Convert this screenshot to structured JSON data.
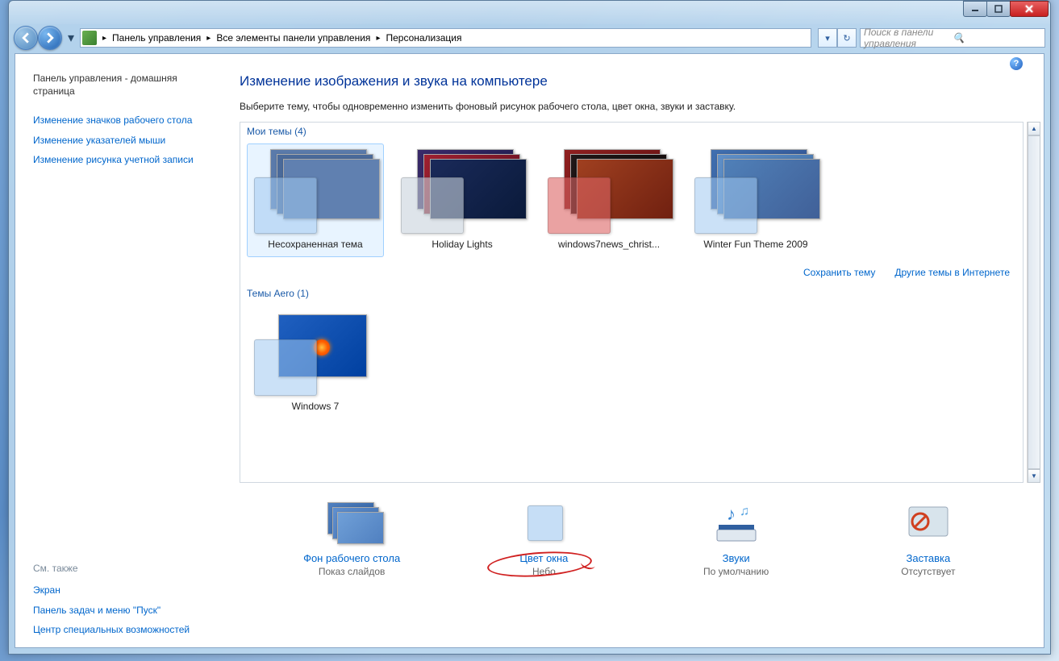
{
  "titlebar": {
    "minimize": "_",
    "maximize": "□",
    "close": "✕"
  },
  "breadcrumb": {
    "items": [
      "Панель управления",
      "Все элементы панели управления",
      "Персонализация"
    ]
  },
  "search": {
    "placeholder": "Поиск в панели управления"
  },
  "sidebar": {
    "home": "Панель управления - домашняя страница",
    "links": [
      "Изменение значков рабочего стола",
      "Изменение указателей мыши",
      "Изменение рисунка учетной записи"
    ],
    "footer_title": "См. также",
    "footer_links": [
      "Экран",
      "Панель задач и меню \"Пуск\"",
      "Центр специальных возможностей"
    ]
  },
  "main": {
    "title": "Изменение изображения и звука на компьютере",
    "subtitle": "Выберите тему, чтобы одновременно изменить фоновый рисунок рабочего стола, цвет окна, звуки и заставку.",
    "sections": {
      "my_themes": "Мои темы (4)",
      "aero_themes": "Темы Aero (1)"
    },
    "themes_my": [
      {
        "label": "Несохраненная тема",
        "swatch": "rgba(160,200,240,0.55)",
        "bg": [
          "#5a7aaa",
          "#4a6a9a",
          "#6080b0"
        ]
      },
      {
        "label": "Holiday Lights",
        "swatch": "rgba(200,210,220,0.6)",
        "bg": [
          "#3a2a6a",
          "#a02030",
          "#1a2a5a"
        ]
      },
      {
        "label": "windows7news_christ...",
        "swatch": "rgba(220,100,100,0.6)",
        "bg": [
          "#902020",
          "#201818",
          "#a04020"
        ]
      },
      {
        "label": "Winter Fun Theme 2009",
        "swatch": "rgba(160,200,240,0.55)",
        "bg": [
          "#4070b0",
          "#6090c8",
          "#5080b8"
        ]
      }
    ],
    "themes_aero": [
      {
        "label": "Windows 7",
        "swatch": "rgba(160,200,240,0.55)"
      }
    ],
    "actions": {
      "save": "Сохранить тему",
      "more": "Другие темы в Интернете"
    },
    "bottom": [
      {
        "link": "Фон рабочего стола",
        "sub": "Показ слайдов"
      },
      {
        "link": "Цвет окна",
        "sub": "Небо"
      },
      {
        "link": "Звуки",
        "sub": "По умолчанию"
      },
      {
        "link": "Заставка",
        "sub": "Отсутствует"
      }
    ]
  }
}
